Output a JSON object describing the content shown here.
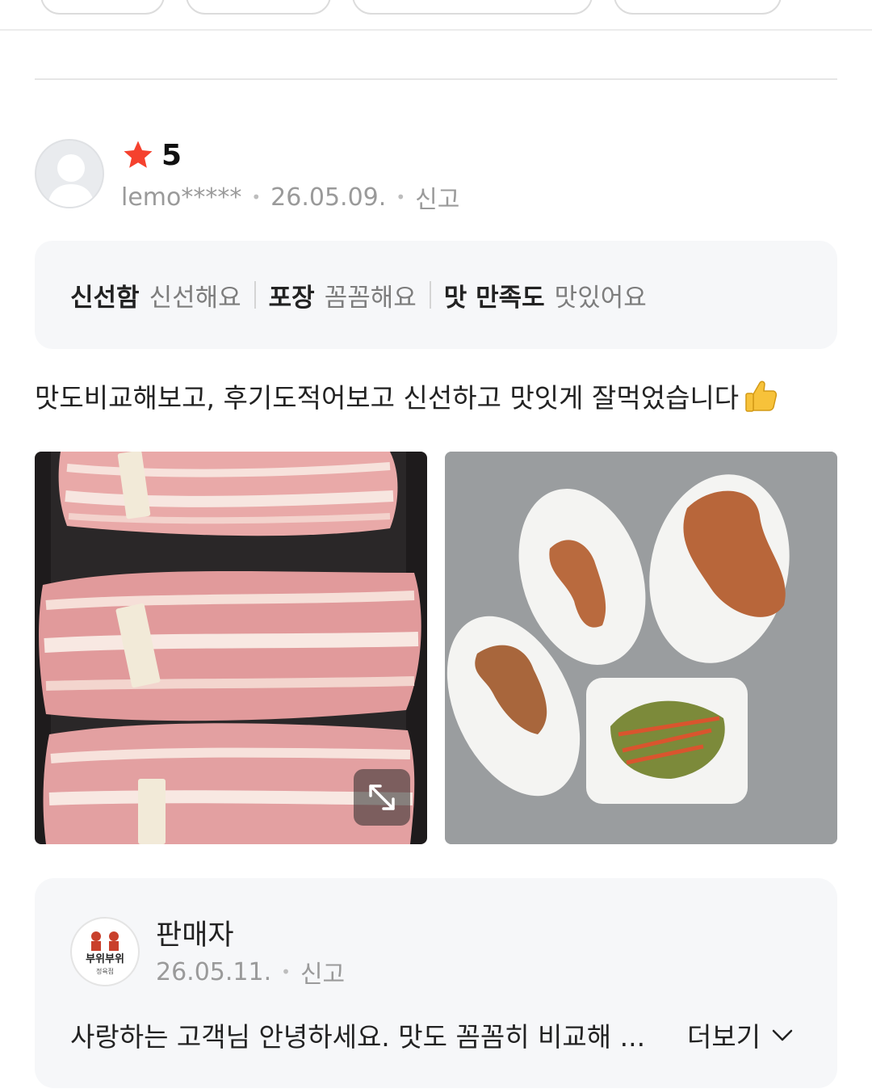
{
  "review": {
    "rating": "5",
    "author": "lemo*****",
    "date": "26.05.09.",
    "report_label": "신고",
    "tags": [
      {
        "key": "신선함",
        "value": "신선해요"
      },
      {
        "key": "포장",
        "value": "꼼꼼해요"
      },
      {
        "key": "맛 만족도",
        "value": "맛있어요"
      }
    ],
    "text": "맛도비교해보고, 후기도적어보고 신선하고 맛잇게 잘먹었습니다",
    "photos": [
      {
        "alt": "포장된 삼겹살 사진"
      },
      {
        "alt": "구운 삼겹살과 파절이 사진"
      }
    ]
  },
  "seller": {
    "name": "판매자",
    "date": "26.05.11.",
    "report_label": "신고",
    "reply_preview": "사랑하는 고객님 안녕하세요. 맛도 꼼꼼히 비교해 ...",
    "more_label": "더보기",
    "logo_text_main": "부위부위",
    "logo_text_sub": "정육점"
  },
  "colors": {
    "star": "#f5412e",
    "muted": "#9a9a9a",
    "box_bg": "#f6f7f9"
  },
  "icons": {
    "rating": "star-icon",
    "thumb": "thumbs-up-icon",
    "expand": "expand-icon",
    "more": "chevron-down-icon"
  }
}
